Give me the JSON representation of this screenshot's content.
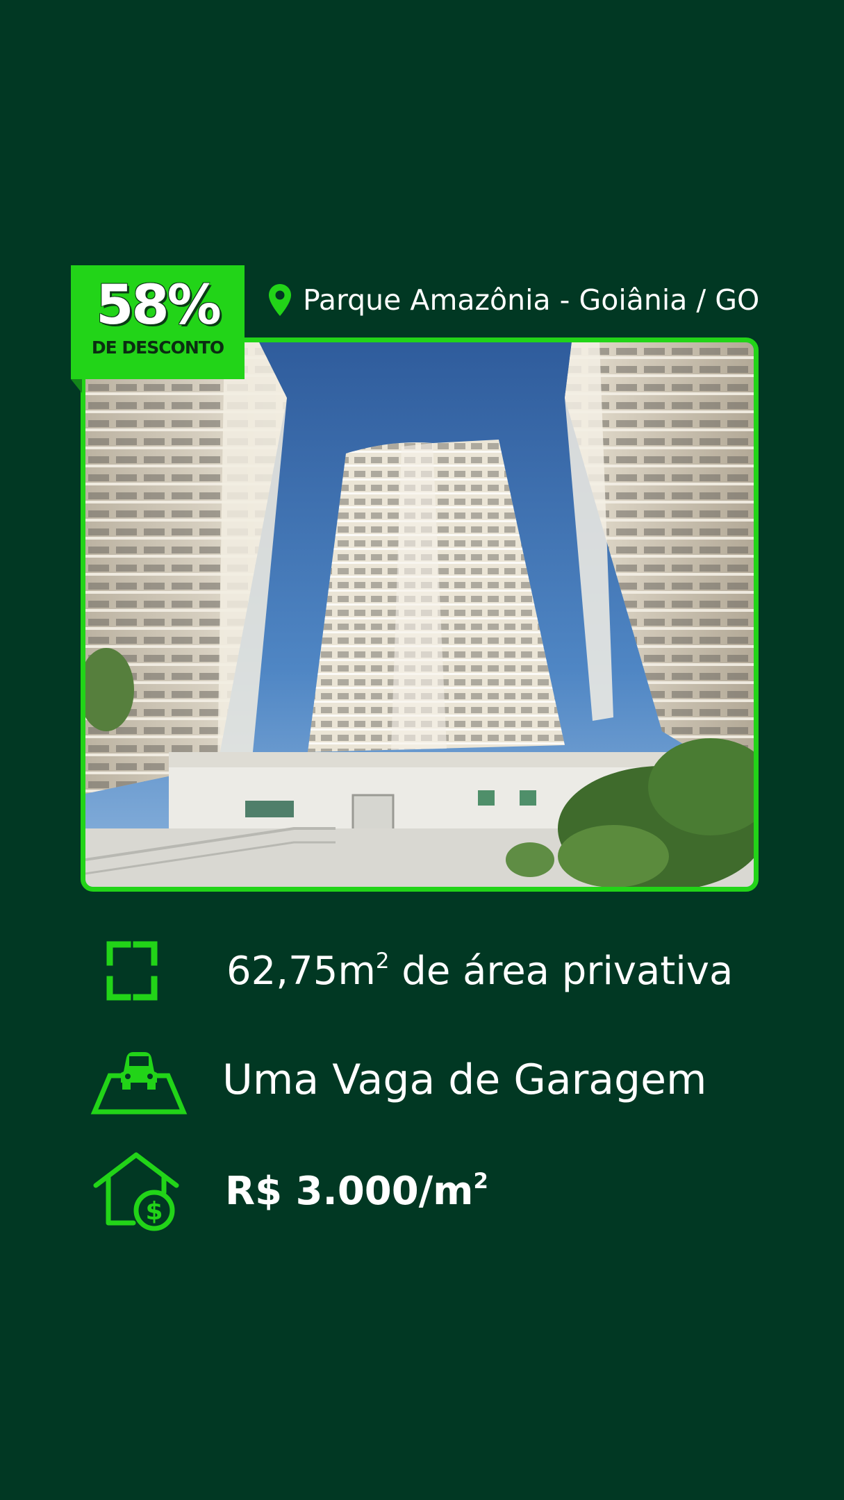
{
  "badge": {
    "percent": "58%",
    "label": "DE DESCONTO"
  },
  "location": {
    "icon": "map-pin-icon",
    "text": "Parque Amazônia - Goiânia / GO"
  },
  "photo": {
    "icon": "building-photo"
  },
  "features": [
    {
      "icon": "area-frame-icon",
      "value": "62,75m",
      "sup": "2",
      "suffix": " de área privativa"
    },
    {
      "icon": "car-parking-icon",
      "text": "Uma Vaga de Garagem"
    },
    {
      "icon": "house-dollar-icon",
      "value": "R$ 3.000/m",
      "sup": "2"
    }
  ],
  "colors": {
    "background": "#013823",
    "accent": "#22d418",
    "text": "#ffffff"
  }
}
